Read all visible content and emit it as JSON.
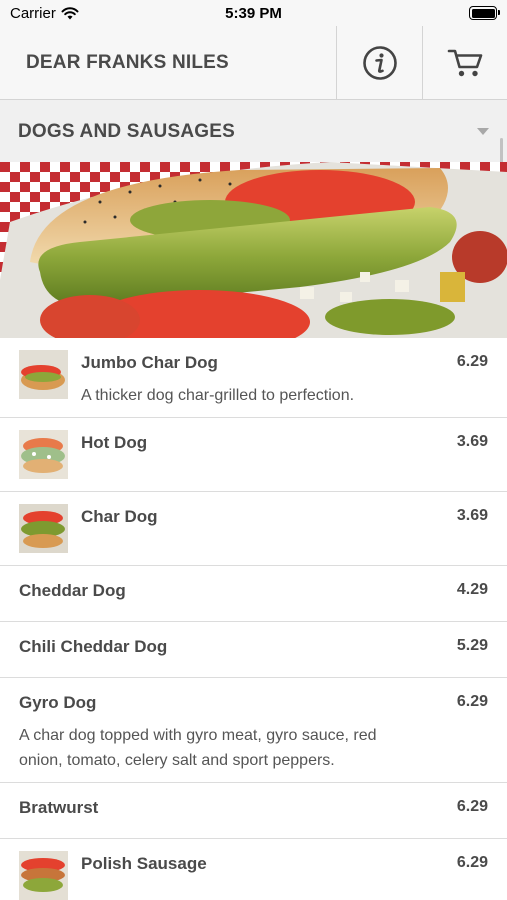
{
  "status_bar": {
    "carrier": "Carrier",
    "time": "5:39 PM"
  },
  "header": {
    "title": "DEAR FRANKS NILES",
    "info_icon": "info-circle-icon",
    "cart_icon": "cart-icon"
  },
  "category": {
    "title": "DOGS AND SAUSAGES"
  },
  "items": [
    {
      "name": "Jumbo Char Dog",
      "price": "6.29",
      "description": "A thicker dog char-grilled to perfection."
    },
    {
      "name": "Hot Dog",
      "price": "3.69"
    },
    {
      "name": "Char Dog",
      "price": "3.69"
    },
    {
      "name": "Cheddar Dog",
      "price": "4.29"
    },
    {
      "name": "Chili Cheddar Dog",
      "price": "5.29"
    },
    {
      "name": "Gyro Dog",
      "price": "6.29",
      "description": "A char dog topped with gyro meat, gyro sauce, red onion, tomato, celery salt and sport peppers."
    },
    {
      "name": "Bratwurst",
      "price": "6.29"
    },
    {
      "name": "Polish Sausage",
      "price": "6.29"
    }
  ],
  "colors": {
    "header_bg": "#f7f7f7",
    "category_bg": "#f0f0f0",
    "text": "#4a4a4a",
    "divider": "#dcdcdc"
  }
}
